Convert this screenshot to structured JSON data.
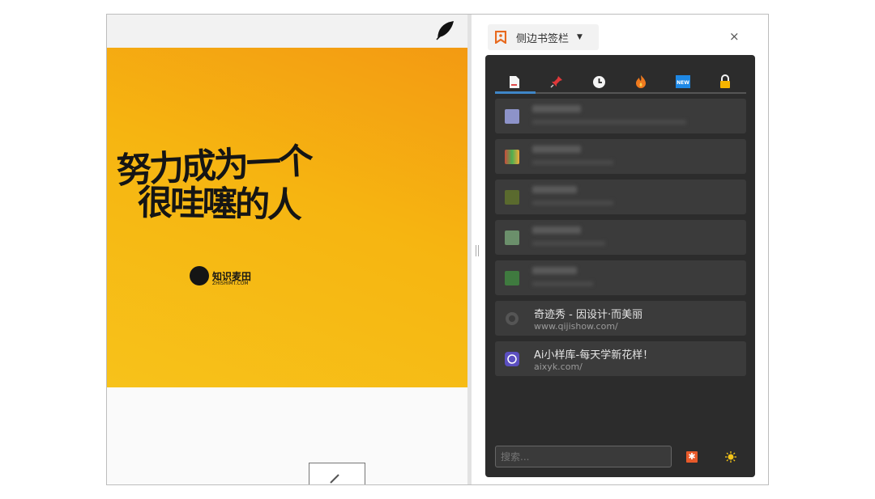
{
  "poster": {
    "line1": "努力成为一个",
    "line2": "很哇噻的人",
    "brand_name": "知识麦田",
    "brand_sub": "ZHISHIMT.COM"
  },
  "sidebar": {
    "title": "侧边书签栏",
    "close": "×",
    "tabs": [
      {
        "icon": "page-icon"
      },
      {
        "icon": "pin-icon"
      },
      {
        "icon": "clock-icon"
      },
      {
        "icon": "fire-icon"
      },
      {
        "icon": "new-icon",
        "label": "NEW"
      },
      {
        "icon": "lock-icon"
      }
    ],
    "bookmarks": [
      {
        "title": "奇迹秀 - 因设计·而美丽",
        "url": "www.qijishow.com/"
      },
      {
        "title": "Ai小样库-每天学新花样！",
        "url": "aixyk.com/"
      }
    ],
    "search_placeholder": "搜索...",
    "star_button": "✱"
  },
  "colors": {
    "accent": "#3f86c8",
    "panel": "#2c2c2c",
    "item": "#3b3b3b"
  }
}
